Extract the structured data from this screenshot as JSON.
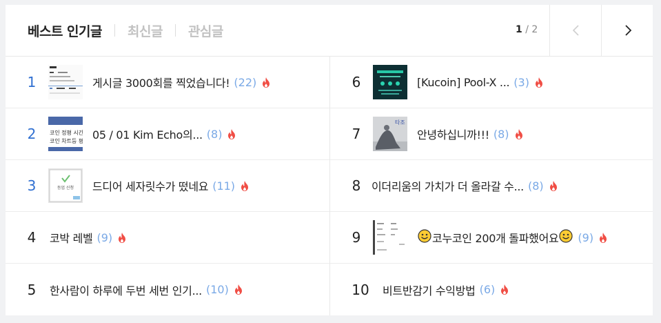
{
  "tabs": [
    {
      "label": "베스트 인기글",
      "active": true
    },
    {
      "label": "최신글",
      "active": false
    },
    {
      "label": "관심글",
      "active": false
    }
  ],
  "pager": {
    "current": "1",
    "separator": " / ",
    "total": "2"
  },
  "icons": {
    "prev": "chevron-left-icon",
    "next": "chevron-right-icon",
    "hot": "fire-icon",
    "emoji": "smiley-emoji-icon"
  },
  "colors": {
    "rank_top": "#2f6fd1",
    "count": "#7aa9e6",
    "fire": "#f04e45"
  },
  "posts": [
    {
      "rank": "1",
      "title": "게시글 3000회를 찍었습니다!",
      "count": "(22)"
    },
    {
      "rank": "2",
      "title": "05 / 01 Kim Echo의...",
      "count": "(8)"
    },
    {
      "rank": "3",
      "title": "드디어 세자릿수가 떴네요",
      "count": "(11)"
    },
    {
      "rank": "4",
      "title": "코박 레벨",
      "count": "(9)"
    },
    {
      "rank": "5",
      "title": "한사람이 하루에 두번 세번 인기...",
      "count": "(10)"
    },
    {
      "rank": "6",
      "title": "[Kucoin] Pool-X ...",
      "count": "(3)"
    },
    {
      "rank": "7",
      "title": "안녕하십니까!!!",
      "count": "(8)"
    },
    {
      "rank": "8",
      "title": "이더리움의 가치가 더 올라갈 수...",
      "count": "(8)"
    },
    {
      "rank": "9",
      "title": "코누코인 200개 돌파했어요",
      "count": "(9)"
    },
    {
      "rank": "10",
      "title": "비트반감기 수익방법",
      "count": "(6)"
    }
  ],
  "thumb_text": {
    "t2_line1": "코인 정평 시간빈",
    "t2_line2": "코인 차트등 평론",
    "t3_label": "등업 신청",
    "t7_label": "타조"
  }
}
